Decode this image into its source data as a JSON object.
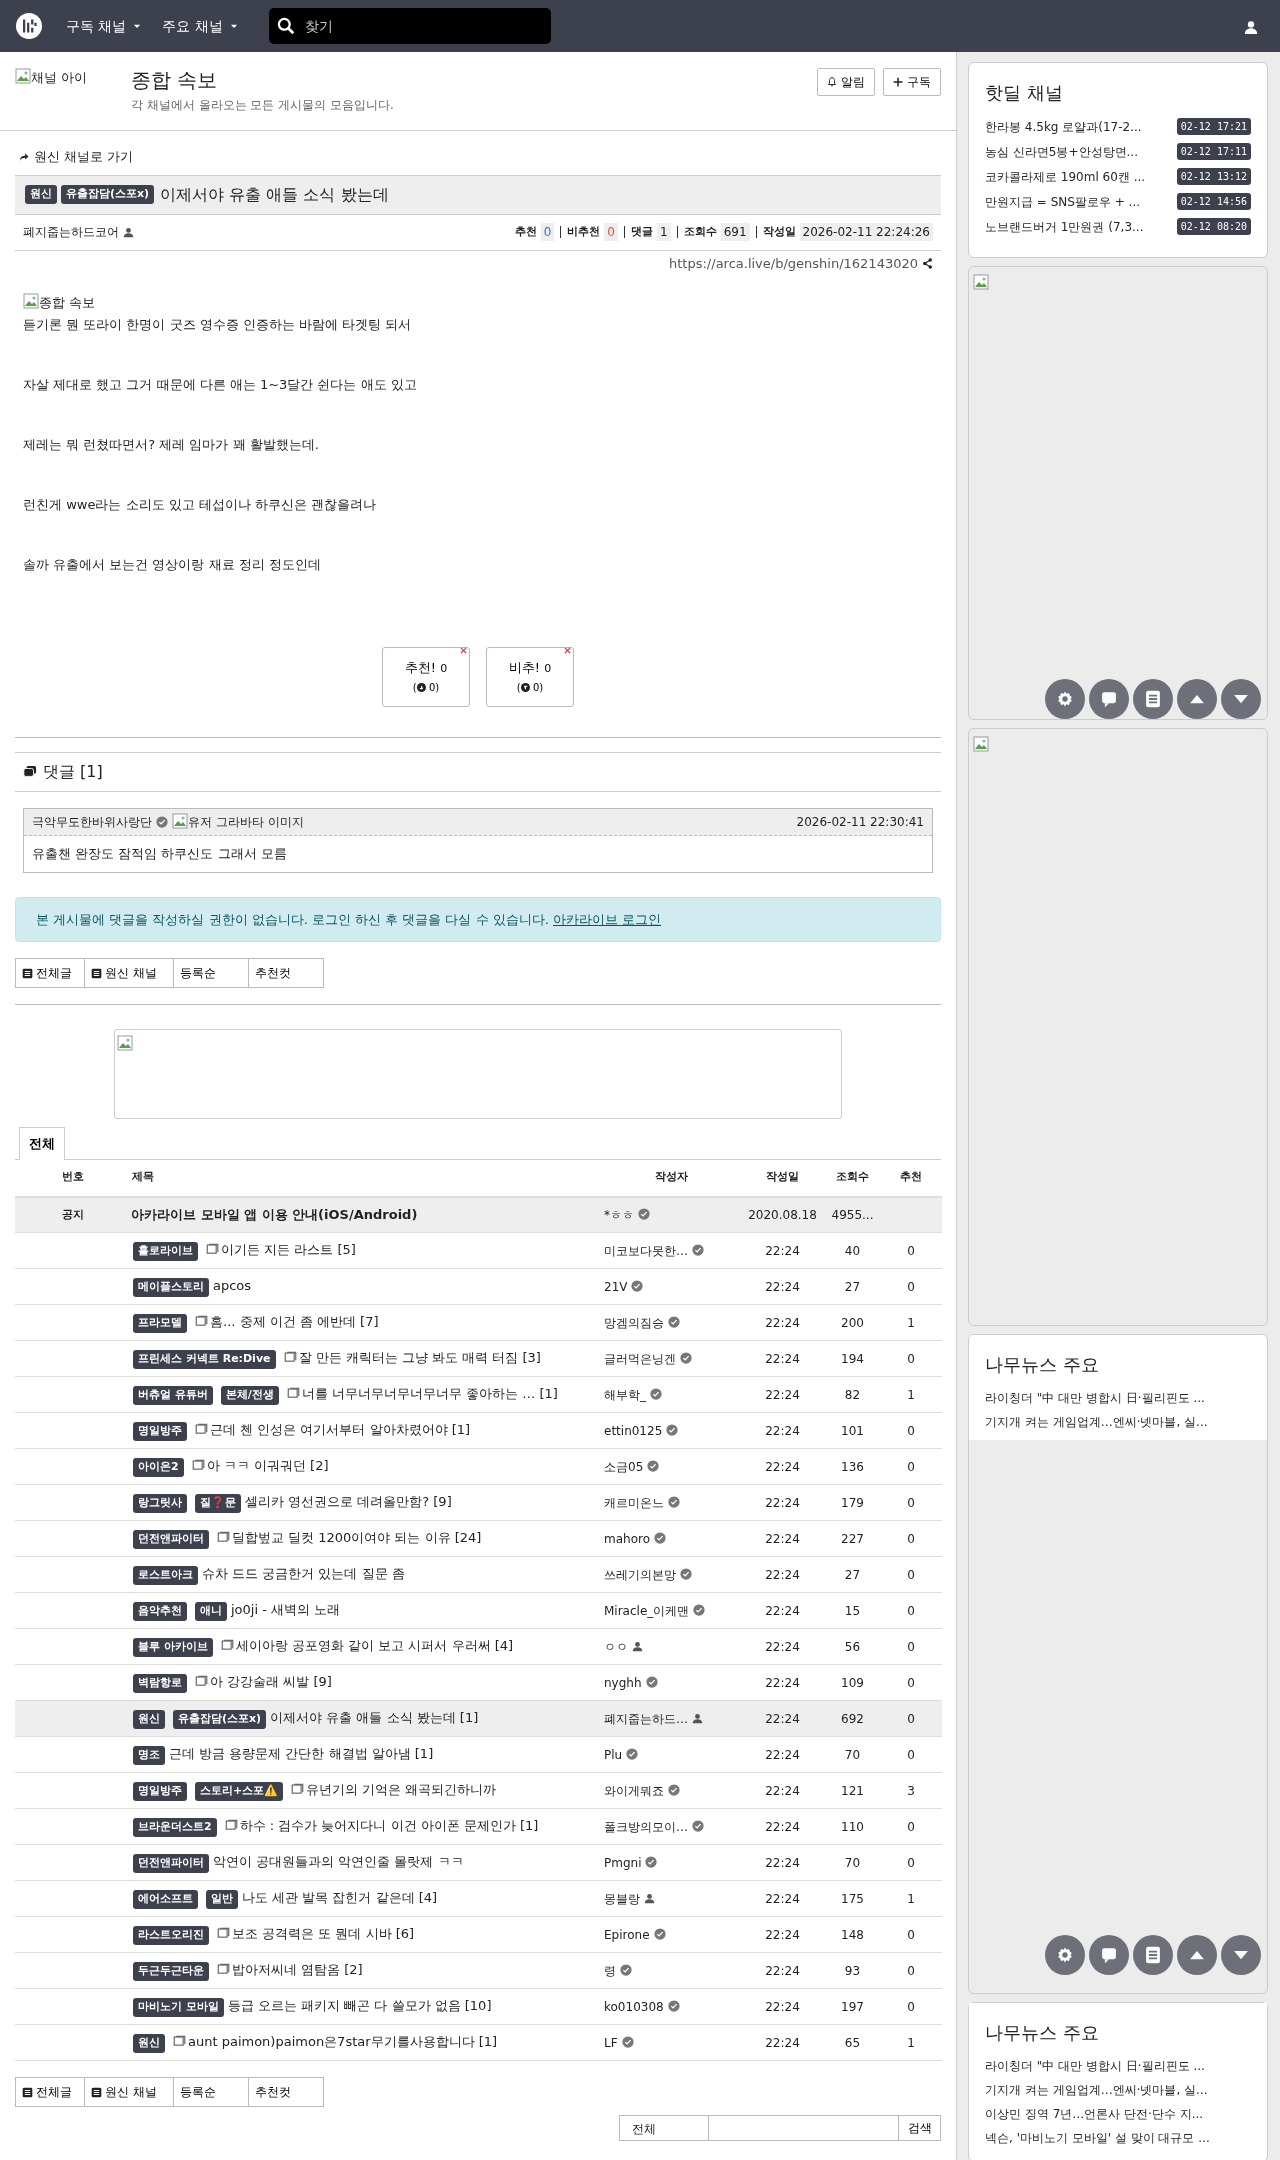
{
  "navbar": {
    "menus": [
      "구독 채널",
      "주요 채널"
    ],
    "search": {
      "placeholder": "찾기"
    }
  },
  "channel": {
    "icon_alt": "채널 아이",
    "title": "종합 속보",
    "description": "각 채널에서 올라오는 모든 게시물의 모음입니다.",
    "buttons": [
      "알림",
      "구독"
    ]
  },
  "article": {
    "back_link": "원신 채널로 가기",
    "badges": [
      "원신",
      "유출잡담(스포x)"
    ],
    "title": "이제서야 유출 애들 소식 봤는데",
    "author": "폐지줍는하드코어",
    "stats": [
      {
        "label": "추천",
        "value": "0",
        "kind": "up"
      },
      {
        "label": "비추천",
        "value": "0",
        "kind": "down"
      },
      {
        "label": "댓글",
        "value": "1",
        "kind": "plain"
      },
      {
        "label": "조회수",
        "value": "691",
        "kind": "plain"
      },
      {
        "label": "작성일",
        "value": "2026-02-11 22:24:26",
        "kind": "plain"
      }
    ],
    "url": "https://arca.live/b/genshin/162143020",
    "image_alt": "종합 속보",
    "paragraphs": [
      "듣기론 뭔 또라이 한명이 굿즈 영수증 인증하는 바람에 타겟팅 되서",
      "자살 제대로 했고 그거 때문에 다른 애는 1~3달간 쉰다는 애도 있고",
      "제레는 뭐 런쳤따면서? 제레 임마가 꽤 활발했는데.",
      "런친게 wwe라는 소리도 있고 테섭이나 하쿠신은 괜찮을려나",
      "솔까 유출에서 보는건 영상이랑 재료 정리 정도인데"
    ],
    "votes": [
      {
        "label": "추천!",
        "count": "0",
        "sub_open": "(",
        "sub": "0)",
        "kind": "up"
      },
      {
        "label": "비추!",
        "count": "0",
        "sub_open": "(",
        "sub": "0)",
        "kind": "down"
      }
    ]
  },
  "comments": {
    "title": "댓글 [1]",
    "items": [
      {
        "author": "극악무도한바위사랑단",
        "avatar_alt": "유저 그라바타 이미지",
        "date": "2026-02-11 22:30:41",
        "text": "유출챈 완장도 잠적임 하쿠신도 그래서 모름"
      }
    ]
  },
  "alert": {
    "text": "본 게시물에 댓글을 작성하실 권한이 없습니다. 로그인 하신 후 댓글을 다실 수 있습니다.",
    "link": "아카라이브 로그인"
  },
  "filters": [
    {
      "label": "전체글",
      "icon": true
    },
    {
      "label": "원신 채널",
      "icon": true
    },
    {
      "label": "등록순",
      "icon": false
    },
    {
      "label": "추천컷",
      "icon": false
    }
  ],
  "tabs": [
    {
      "label": "전체",
      "selected": true
    }
  ],
  "table": {
    "columns": [
      "번호",
      "제목",
      "작성자",
      "작성일",
      "조회수",
      "추천"
    ],
    "notice": {
      "number": "공지",
      "title": "아카라이브 모바일 앱 이용 안내(iOS/Android)",
      "author": "*ㅎㅎ",
      "date": "2020.08.18",
      "views": "4955..."
    },
    "rows": [
      {
        "badges": [
          "홀로라이브"
        ],
        "image": true,
        "title": "이기든 지든 라스트 [5]",
        "author": "미코보다못한…",
        "verified": true,
        "date": "22:24",
        "views": "40",
        "votes": "0",
        "selected": false
      },
      {
        "badges": [
          "메이플스토리"
        ],
        "image": false,
        "title": "apcos",
        "author": "21V",
        "verified": true,
        "date": "22:24",
        "views": "27",
        "votes": "0",
        "selected": false
      },
      {
        "badges": [
          "프라모델"
        ],
        "image": true,
        "title": "흠... 중제 이건 좀 에반데 [7]",
        "author": "망겜의짐승",
        "verified": true,
        "date": "22:24",
        "views": "200",
        "votes": "1",
        "selected": false
      },
      {
        "badges": [
          "프린세스 커넥트 Re:Dive"
        ],
        "image": true,
        "title": "잘 만든 캐릭터는 그냥 봐도 매력 터짐 [3]",
        "author": "글러먹은닝겐",
        "verified": true,
        "date": "22:24",
        "views": "194",
        "votes": "0",
        "selected": false
      },
      {
        "badges": [
          "버츄얼 유튜버",
          "본체/전생"
        ],
        "image": true,
        "title": "너를 너무너무너무너무너무 좋아하는 … [1]",
        "author": "해부학_",
        "verified": true,
        "date": "22:24",
        "views": "82",
        "votes": "1",
        "selected": false
      },
      {
        "badges": [
          "명일방주"
        ],
        "image": true,
        "title": "근데 첸 인성은 여기서부터 알아차렸어야 [1]",
        "author": "ettin0125",
        "verified": true,
        "date": "22:24",
        "views": "101",
        "votes": "0",
        "selected": false
      },
      {
        "badges": [
          "아이온2"
        ],
        "image": true,
        "title": "아 ㅋㅋ 이궈궈던 [2]",
        "author": "소금05",
        "verified": true,
        "date": "22:24",
        "views": "136",
        "votes": "0",
        "selected": false
      },
      {
        "badges": [
          "랑그릿사",
          "질❓문"
        ],
        "image": false,
        "title": "셀리카 영선권으로 데려올만함? [9]",
        "author": "캐르미온느",
        "verified": true,
        "date": "22:24",
        "views": "179",
        "votes": "0",
        "selected": false
      },
      {
        "badges": [
          "던전앤파이터"
        ],
        "image": true,
        "title": "딜합벞교 딜컷 1200이여야 되는 이유 [24]",
        "author": "mahoro",
        "verified": true,
        "date": "22:24",
        "views": "227",
        "votes": "0",
        "selected": false
      },
      {
        "badges": [
          "로스트아크"
        ],
        "image": false,
        "title": "슈차 드드 궁금한거 있는데 질문 좀",
        "author": "쓰레기의본망",
        "verified": true,
        "date": "22:24",
        "views": "27",
        "votes": "0",
        "selected": false
      },
      {
        "badges": [
          "음악추천",
          "애니"
        ],
        "image": false,
        "title": "jo0ji - 새벽의 노래",
        "author": "Miracle_이케맨",
        "verified": true,
        "date": "22:24",
        "views": "15",
        "votes": "0",
        "selected": false
      },
      {
        "badges": [
          "블루 아카이브"
        ],
        "image": true,
        "title": "세이아랑 공포영화 같이 보고 시퍼서 우러써 [4]",
        "author": "ㅇㅇ",
        "verified": false,
        "date": "22:24",
        "views": "56",
        "votes": "0",
        "selected": false
      },
      {
        "badges": [
          "벽람항로"
        ],
        "image": true,
        "title": "아 강강술래 씨발 [9]",
        "author": "nyghh",
        "verified": true,
        "date": "22:24",
        "views": "109",
        "votes": "0",
        "selected": false
      },
      {
        "badges": [
          "원신",
          "유출잡담(스포x)"
        ],
        "image": false,
        "title": "이제서야 유출 애들 소식 봤는데 [1]",
        "author": "폐지줍는하드…",
        "verified": false,
        "date": "22:24",
        "views": "692",
        "votes": "0",
        "selected": true
      },
      {
        "badges": [
          "명조"
        ],
        "image": false,
        "title": "근데 방금 용량문제 간단한 해결법 알아냄 [1]",
        "author": "Plu",
        "verified": true,
        "date": "22:24",
        "views": "70",
        "votes": "0",
        "selected": false
      },
      {
        "badges": [
          "명일방주",
          "스토리+스포⚠️"
        ],
        "image": true,
        "title": "유년기의 기억은 왜곡되긴하니까",
        "author": "와이게뭐죠",
        "verified": true,
        "date": "22:24",
        "views": "121",
        "votes": "3",
        "selected": false
      },
      {
        "badges": [
          "브라운더스트2"
        ],
        "image": true,
        "title": "하수 : 검수가 늦어지다니 이건 아이폰 문제인가 [1]",
        "author": "폴크방의모이…",
        "verified": true,
        "date": "22:24",
        "views": "110",
        "votes": "0",
        "selected": false
      },
      {
        "badges": [
          "던전앤파이터"
        ],
        "image": false,
        "title": "악연이 공대원들과의 악연인줄 몰랏제 ㅋㅋ",
        "author": "Pmgni",
        "verified": true,
        "date": "22:24",
        "views": "70",
        "votes": "0",
        "selected": false
      },
      {
        "badges": [
          "에어소프트",
          "일반"
        ],
        "image": false,
        "title": "나도 세관 발목 잡힌거 같은데 [4]",
        "author": "몽블랑",
        "verified": false,
        "date": "22:24",
        "views": "175",
        "votes": "1",
        "selected": false
      },
      {
        "badges": [
          "라스트오리진"
        ],
        "image": true,
        "title": "보조 공격력은 또 뭔데 시바 [6]",
        "author": "Epirone",
        "verified": true,
        "date": "22:24",
        "views": "148",
        "votes": "0",
        "selected": false
      },
      {
        "badges": [
          "두근두근타운"
        ],
        "image": true,
        "title": "밥아저씨네 염탐옴 [2]",
        "author": "령",
        "verified": true,
        "date": "22:24",
        "views": "93",
        "votes": "0",
        "selected": false
      },
      {
        "badges": [
          "마비노기 모바일"
        ],
        "image": false,
        "title": "등급 오르는 패키지 빼곤 다 쓸모가 없음 [10]",
        "author": "ko010308",
        "verified": true,
        "date": "22:24",
        "views": "197",
        "votes": "0",
        "selected": false
      },
      {
        "badges": [
          "원신"
        ],
        "image": true,
        "title": "aunt paimon)paimon은7star무기를사용합니다 [1]",
        "author": "LF",
        "verified": true,
        "date": "22:24",
        "views": "65",
        "votes": "1",
        "selected": false
      }
    ]
  },
  "bottom_filters": [
    {
      "label": "전체글",
      "icon": true
    },
    {
      "label": "원신 채널",
      "icon": true
    },
    {
      "label": "등록순",
      "icon": false
    },
    {
      "label": "추천컷",
      "icon": false
    }
  ],
  "search_form": {
    "scope": "전체",
    "button": "검색"
  },
  "sidebar": {
    "hotdeal": {
      "title": "핫딜 채널",
      "items": [
        {
          "text": "한라봉 4.5kg 로얄과(17-2...",
          "time": "02-12 17:21"
        },
        {
          "text": "농심 신라면5봉+안성탕면...",
          "time": "02-12 17:11"
        },
        {
          "text": "코카콜라제로 190ml 60캔 ...",
          "time": "02-12 13:12"
        },
        {
          "text": "만원지급 = SNS팔로우 + ...",
          "time": "02-12 14:56"
        },
        {
          "text": "노브랜드버거 1만원권 (7,3...",
          "time": "02-12 08:20"
        }
      ]
    },
    "news": [
      {
        "title": "나무뉴스 주요",
        "items": [
          "라이칭더 \"中 대만 병합시 日·필리핀도 ...",
          "기지개 켜는 게임업계…엔씨·넷마블, 실..."
        ]
      },
      {
        "title": "나무뉴스 주요",
        "items": [
          "라이칭더 \"中 대만 병합시 日·필리핀도 ...",
          "기지개 켜는 게임업계…엔씨·넷마블, 실...",
          "이상민 징역 7년…언론사 단전·단수 지...",
          "넥슨, '마비노기 모바일' 설 맞이 대규모 ..."
        ]
      }
    ]
  }
}
